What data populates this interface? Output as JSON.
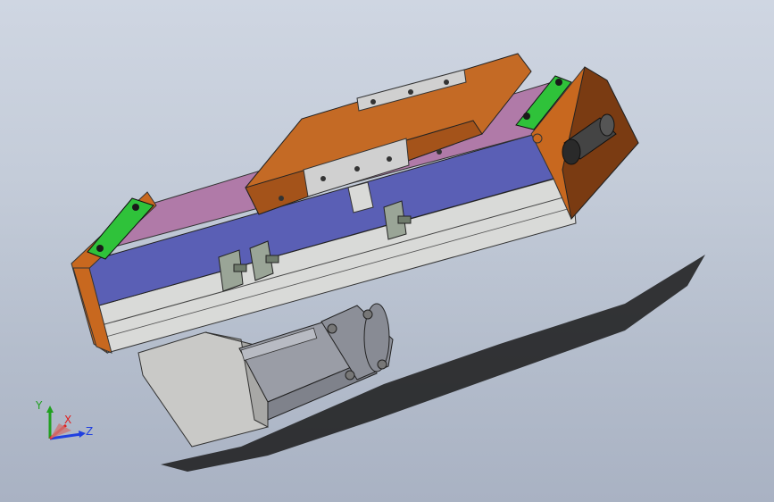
{
  "viewport": {
    "background_top": "#cfd6e2",
    "background_bottom": "#a9b2c3"
  },
  "model": {
    "colors": {
      "end_cap": "#c8681f",
      "end_cap_dark": "#7a3b12",
      "carriage": "#c46a25",
      "cover_blue": "#5a5fb5",
      "belt_mauve": "#b07aa8",
      "profile_gray": "#d9dad8",
      "motor_gray": "#9a9da6",
      "mount_gray": "#c9c9c7",
      "green_pad": "#2fc23a",
      "shadow": "#1a1a1a"
    },
    "parts": {
      "sensor_icon": "sensor-bracket-icon",
      "motor_icon": "servo-motor-icon",
      "connector_icon": "cable-connector-icon"
    }
  },
  "triad": {
    "x_label": "X",
    "y_label": "Y",
    "z_label": "Z",
    "x_color": "#e02020",
    "y_color": "#20a020",
    "z_color": "#2040e0"
  }
}
